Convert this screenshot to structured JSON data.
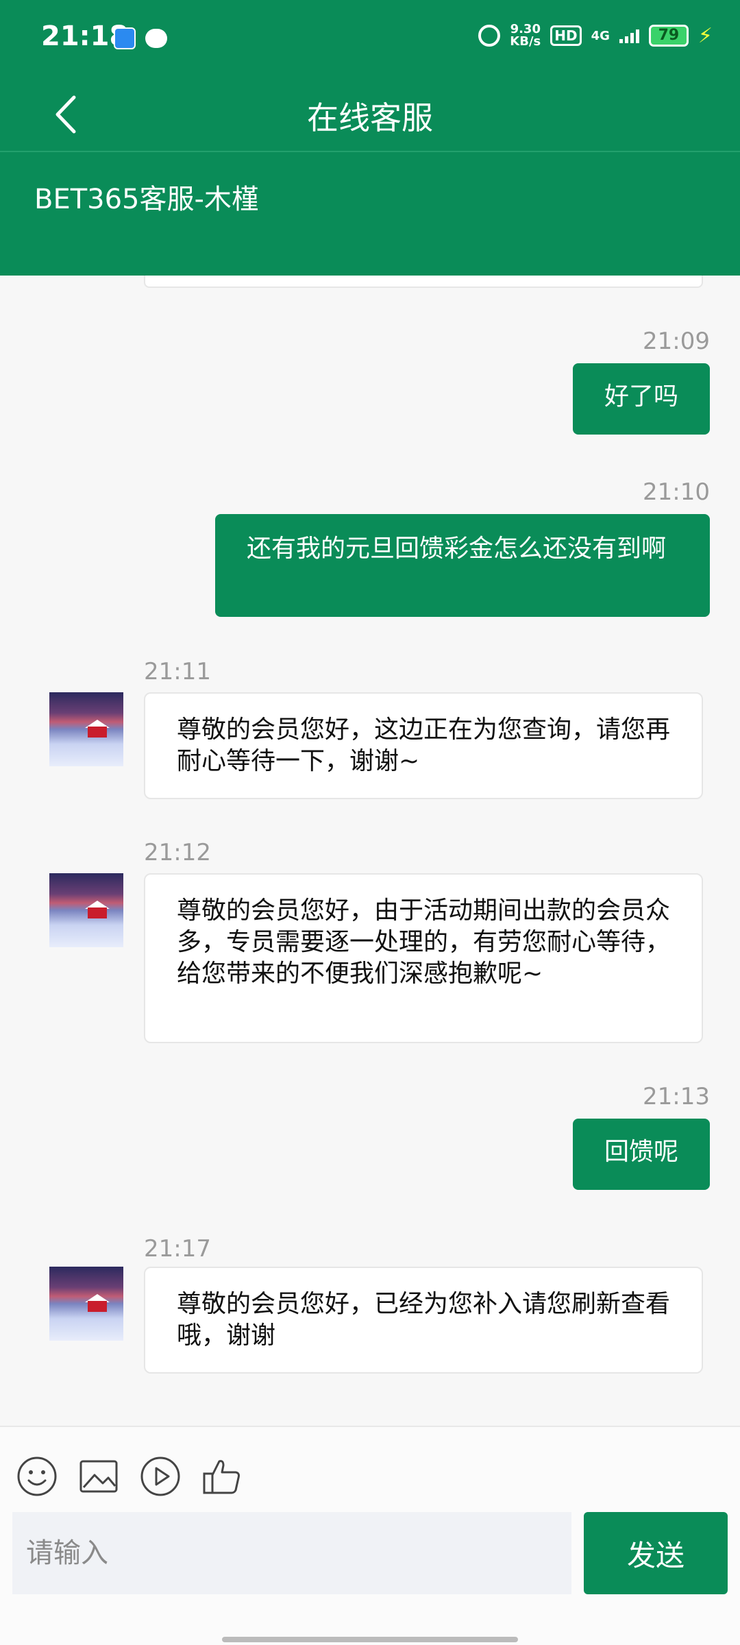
{
  "status_bar": {
    "time": "21:18",
    "net_speed_value": "9.30",
    "net_speed_unit": "KB/s",
    "hd": "HD",
    "network": "4G",
    "battery": "79"
  },
  "header": {
    "title": "在线客服",
    "agent_name": "BET365客服-木槿"
  },
  "messages": [
    {
      "time": "21:09",
      "side": "out",
      "text": "好了吗"
    },
    {
      "time": "21:10",
      "side": "out",
      "text": "还有我的元旦回馈彩金怎么还没有到啊"
    },
    {
      "time": "21:11",
      "side": "in",
      "text": "尊敬的会员您好，这边正在为您查询，请您再耐心等待一下，谢谢~"
    },
    {
      "time": "21:12",
      "side": "in",
      "text": "尊敬的会员您好，由于活动期间出款的会员众多，专员需要逐一处理的，有劳您耐心等待，给您带来的不便我们深感抱歉呢~"
    },
    {
      "time": "21:13",
      "side": "out",
      "text": "回馈呢"
    },
    {
      "time": "21:17",
      "side": "in",
      "text": "尊敬的会员您好，已经为您补入请您刷新查看哦，谢谢"
    }
  ],
  "composer": {
    "placeholder": "请输入",
    "send_label": "发送",
    "tools": [
      "emoji-icon",
      "image-icon",
      "play-icon",
      "thumbs-up-icon"
    ]
  },
  "colors": {
    "brand_green": "#0a8c58",
    "background": "#f7f7f7"
  }
}
